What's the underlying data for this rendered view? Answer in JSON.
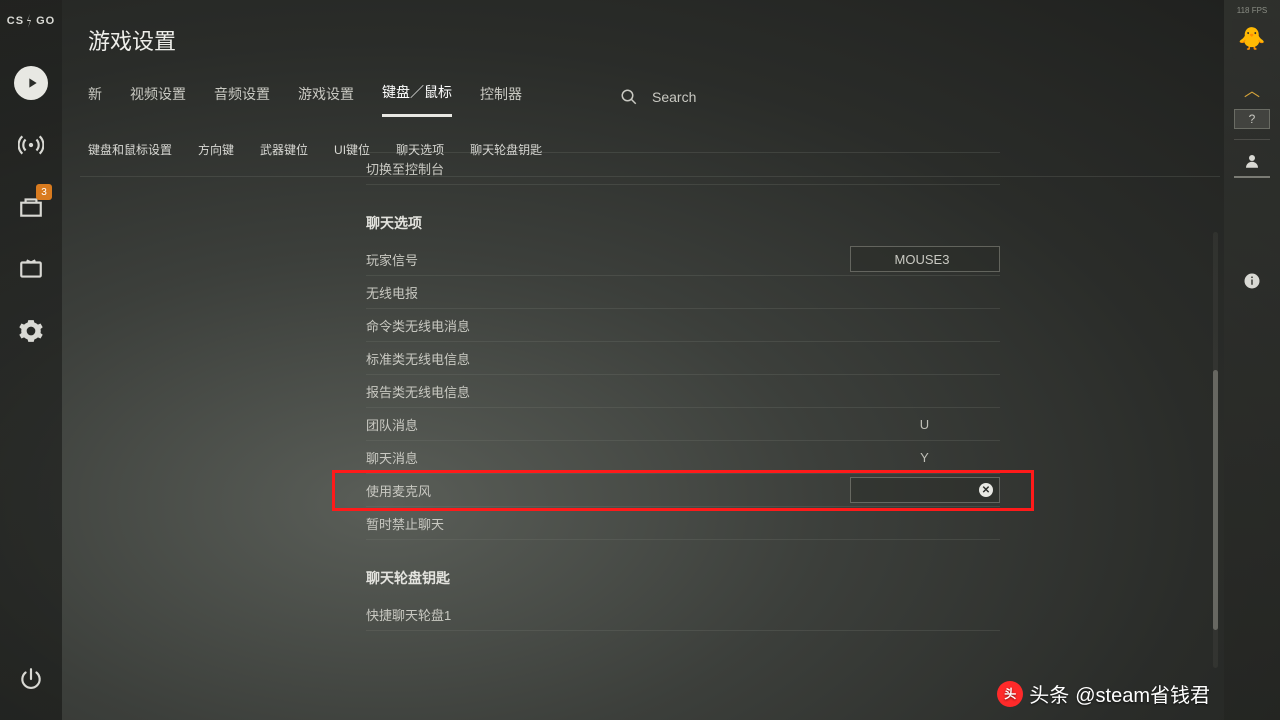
{
  "app": {
    "logo_left": "CS",
    "logo_right": "GO",
    "title": "游戏设置",
    "fps_label": "118 FPS"
  },
  "left_rail": {
    "inbox_badge": "3"
  },
  "right_rail": {
    "help": "?"
  },
  "tabs": {
    "items": [
      {
        "label": "新"
      },
      {
        "label": "视频设置"
      },
      {
        "label": "音频设置"
      },
      {
        "label": "游戏设置"
      },
      {
        "label": "键盘／鼠标",
        "active": true
      },
      {
        "label": "控制器"
      }
    ],
    "search_placeholder": "Search"
  },
  "subnav": {
    "items": [
      {
        "label": "键盘和鼠标设置"
      },
      {
        "label": "方向键"
      },
      {
        "label": "武器键位"
      },
      {
        "label": "UI键位"
      },
      {
        "label": "聊天选项"
      },
      {
        "label": "聊天轮盘钥匙"
      }
    ]
  },
  "partial_row": {
    "label": "切换至控制台",
    "value": ""
  },
  "sections": [
    {
      "title": "聊天选项",
      "rows": [
        {
          "label": "玩家信号",
          "value": "MOUSE3",
          "boxed": true
        },
        {
          "label": "无线电报",
          "value": ""
        },
        {
          "label": "命令类无线电消息",
          "value": ""
        },
        {
          "label": "标准类无线电信息",
          "value": ""
        },
        {
          "label": "报告类无线电信息",
          "value": ""
        },
        {
          "label": "团队消息",
          "value": "U"
        },
        {
          "label": "聊天消息",
          "value": "Y"
        },
        {
          "label": "使用麦克风",
          "value": "",
          "boxed": true,
          "clear": true,
          "highlight": true
        },
        {
          "label": "暂时禁止聊天",
          "value": ""
        }
      ]
    },
    {
      "title": "聊天轮盘钥匙",
      "rows": [
        {
          "label": "快捷聊天轮盘1",
          "value": ""
        }
      ]
    }
  ],
  "watermark": {
    "prefix": "头条",
    "handle": "@steam省钱君"
  }
}
